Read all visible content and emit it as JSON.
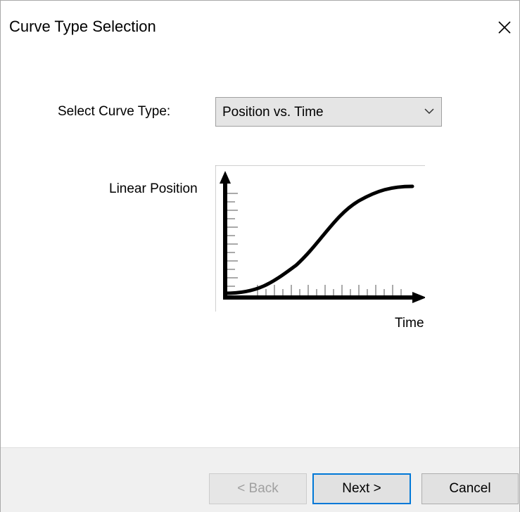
{
  "window": {
    "title": "Curve Type Selection"
  },
  "icons": {
    "close": "close-icon",
    "dropdown": "chevron-down-icon"
  },
  "form": {
    "curve_type_label": "Select Curve Type:",
    "curve_type_value": "Position vs. Time"
  },
  "preview": {
    "y_label": "Linear Position",
    "x_label": "Time"
  },
  "buttons": {
    "back": "< Back",
    "next": "Next >",
    "cancel": "Cancel"
  },
  "colors": {
    "accent": "#0078d7",
    "footer_bg": "#f0f0f0",
    "select_bg": "#e5e5e5"
  }
}
